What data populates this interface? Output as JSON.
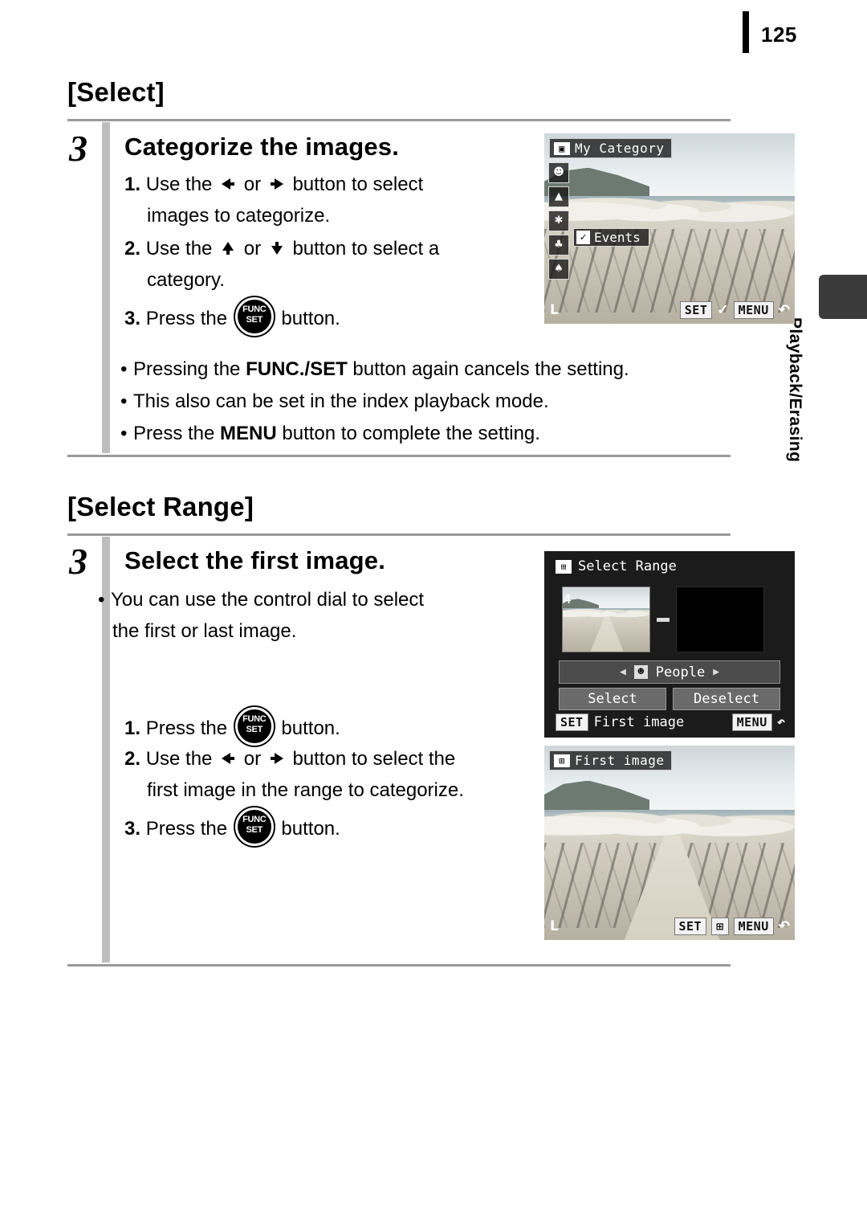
{
  "page": {
    "number": "125",
    "side_tab": "Playback/Erasing"
  },
  "sections": [
    {
      "title": "[Select]",
      "step_number": "3",
      "step_title": "Categorize the images.",
      "instructions": [
        {
          "num": "1.",
          "text_a": "Use the",
          "icon_a": "left-arrow-button",
          "mid": "or",
          "icon_b": "right-arrow-button",
          "text_b": "button to select",
          "cont": "images to categorize."
        },
        {
          "num": "2.",
          "text_a": "Use the",
          "icon_a": "up-arrow-button",
          "mid": "or",
          "icon_b": "down-arrow-button",
          "text_b": "button to select a",
          "cont": "category."
        },
        {
          "num": "3.",
          "text_a": "Press the",
          "icon_a": "func-set-button",
          "text_b": "button."
        }
      ],
      "bullets": [
        {
          "pre": "Pressing the ",
          "bold": "FUNC./SET",
          "post": " button again cancels the setting."
        },
        {
          "pre": "This also can be set in the index playback mode.",
          "bold": "",
          "post": ""
        },
        {
          "pre": "Press the ",
          "bold": "MENU",
          "post": " button to complete the setting."
        }
      ]
    },
    {
      "title": "[Select Range]",
      "step_number": "3",
      "step_title": "Select the first image.",
      "bullets": [
        {
          "pre": "You can use the control dial to select",
          "bold": "",
          "post": ""
        }
      ],
      "bullet_cont": "the first or last image.",
      "instructions": [
        {
          "num": "1.",
          "text_a": "Press the",
          "icon_a": "func-set-button",
          "text_b": "button."
        },
        {
          "num": "2.",
          "text_a": "Use the",
          "icon_a": "left-arrow-button",
          "mid": "or",
          "icon_b": "right-arrow-button",
          "text_b": "button to select the",
          "cont": "first image in the range to categorize."
        },
        {
          "num": "3.",
          "text_a": "Press the",
          "icon_a": "func-set-button",
          "text_b": "button."
        }
      ]
    }
  ],
  "screens": {
    "my_category": {
      "title": "My Category",
      "title_icon": "my-category-icon",
      "category_icons": [
        "people-icon",
        "scenery-icon",
        "events-icon",
        "category1-icon",
        "category2-icon"
      ],
      "selected_label": "Events",
      "check_mark": "✓",
      "corner_quality": "L",
      "keys": {
        "set": "SET",
        "set_mark": "✓",
        "menu": "MENU",
        "back": "↶"
      }
    },
    "select_range": {
      "title": "Select Range",
      "title_icon": "select-range-icon",
      "thumb_index": "4",
      "category_row": {
        "icon": "people-icon",
        "label": "People",
        "left_arrow": "◀",
        "right_arrow": "▶"
      },
      "buttons": {
        "select": "Select",
        "deselect": "Deselect"
      },
      "footer": {
        "set_key": "SET",
        "set_text": "First image",
        "menu_key": "MENU",
        "back": "↶"
      }
    },
    "first_image": {
      "title": "First image",
      "title_icon": "select-range-icon",
      "corner_quality": "L",
      "keys": {
        "set": "SET",
        "set_icon": "select-range-icon",
        "menu": "MENU",
        "back": "↶"
      }
    }
  }
}
